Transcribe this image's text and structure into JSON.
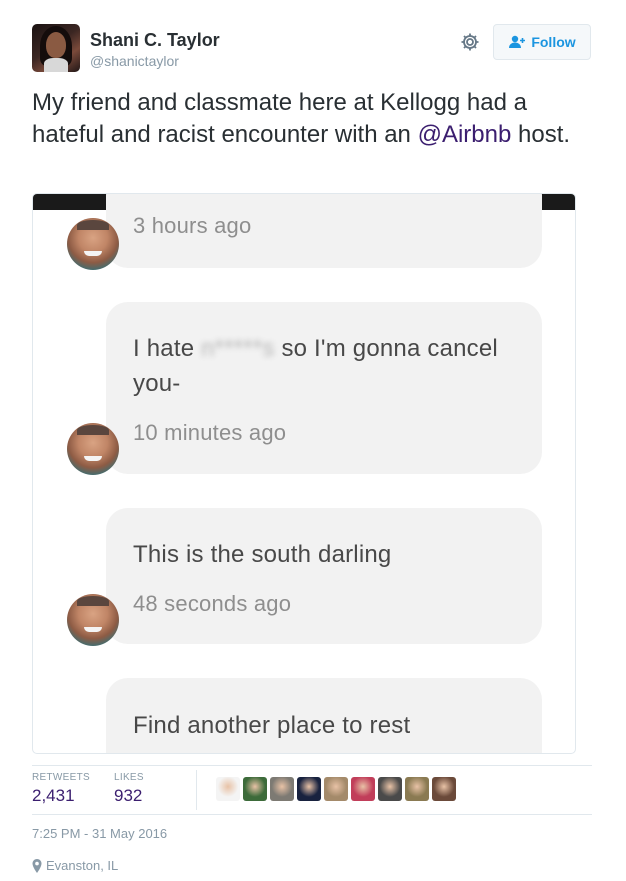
{
  "user": {
    "display_name": "Shani C. Taylor",
    "handle": "@shanictaylor"
  },
  "follow_button": {
    "label": "Follow"
  },
  "tweet": {
    "text_before": "My friend and classmate here at Kellogg had a hateful and racist encounter with an ",
    "mention": "@Airbnb",
    "text_after": " host."
  },
  "screenshot": {
    "messages": [
      {
        "text_prefix": "",
        "blurred_word": "",
        "text_suffix": "",
        "time": "3 hours ago"
      },
      {
        "text_prefix": "I hate ",
        "blurred_word": "n*****s",
        "text_suffix": " so I'm gonna cancel you-",
        "time": "10 minutes ago"
      },
      {
        "text_prefix": "This is the south darling",
        "blurred_word": "",
        "text_suffix": "",
        "time": "48 seconds ago"
      },
      {
        "text_prefix": "Find another place to rest",
        "blurred_word": "",
        "text_suffix": "",
        "time": ""
      }
    ]
  },
  "stats": {
    "retweets_label": "RETWEETS",
    "retweets_value": "2,431",
    "likes_label": "LIKES",
    "likes_value": "932"
  },
  "likers": [
    {
      "name": "liker-1",
      "color": "#f4f4f4"
    },
    {
      "name": "liker-2",
      "color": "#3d6b3a"
    },
    {
      "name": "liker-3",
      "color": "#7d7a73"
    },
    {
      "name": "liker-4",
      "color": "#18223f"
    },
    {
      "name": "liker-5",
      "color": "#a48a6a"
    },
    {
      "name": "liker-6",
      "color": "#c13e5a"
    },
    {
      "name": "liker-7",
      "color": "#4a4a4a"
    },
    {
      "name": "liker-8",
      "color": "#8a7a52"
    },
    {
      "name": "liker-9",
      "color": "#6b4a3a"
    }
  ],
  "meta": {
    "timestamp": "7:25 PM - 31 May 2016",
    "location": "Evanston, IL"
  },
  "colors": {
    "link": "#3b1e6f",
    "follow_blue": "#1b95e0",
    "muted": "#8899a6"
  }
}
